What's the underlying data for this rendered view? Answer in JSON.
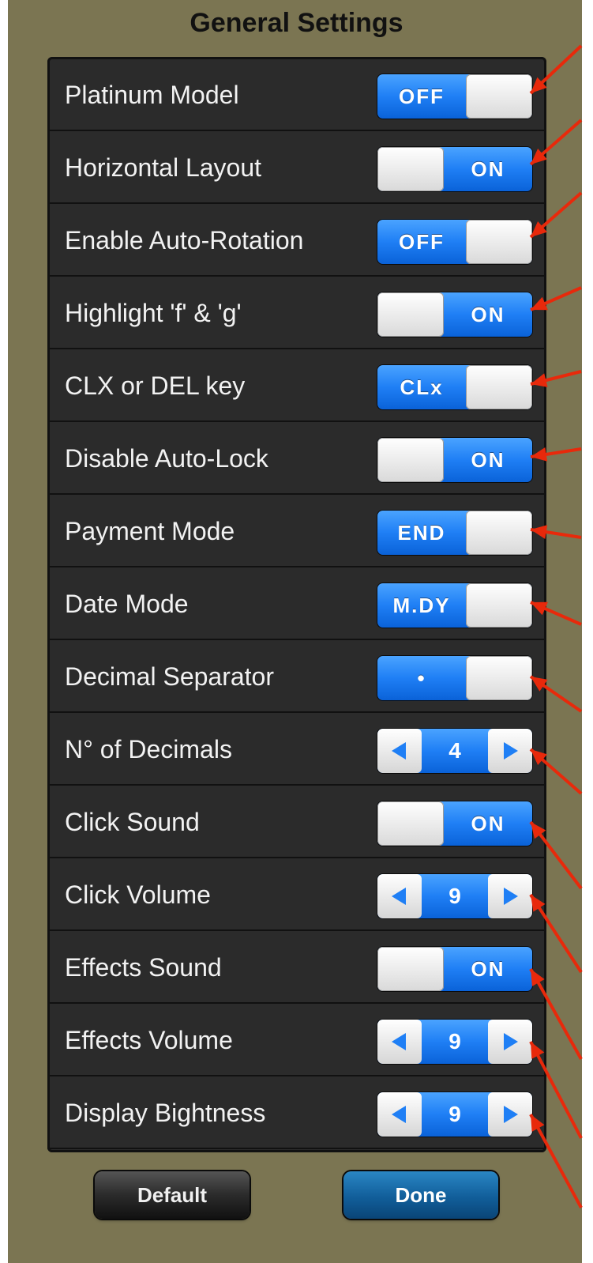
{
  "title": "General Settings",
  "rows": [
    {
      "label": "Platinum Model",
      "control": "switch",
      "state": "off",
      "text": "OFF"
    },
    {
      "label": "Horizontal Layout",
      "control": "switch",
      "state": "on",
      "text": "ON"
    },
    {
      "label": "Enable Auto-Rotation",
      "control": "switch",
      "state": "off",
      "text": "OFF"
    },
    {
      "label": "Highlight 'f' & 'g'",
      "control": "switch",
      "state": "on",
      "text": "ON"
    },
    {
      "label": "CLX or DEL key",
      "control": "switch",
      "state": "off",
      "text": "CLx"
    },
    {
      "label": "Disable Auto-Lock",
      "control": "switch",
      "state": "on",
      "text": "ON"
    },
    {
      "label": "Payment Mode",
      "control": "switch",
      "state": "off",
      "text": "END"
    },
    {
      "label": "Date Mode",
      "control": "switch",
      "state": "off",
      "text": "M.DY"
    },
    {
      "label": "Decimal Separator",
      "control": "switch",
      "state": "off",
      "text": "•"
    },
    {
      "label": "N° of Decimals",
      "control": "stepper",
      "text": "4"
    },
    {
      "label": "Click Sound",
      "control": "switch",
      "state": "on",
      "text": "ON"
    },
    {
      "label": "Click Volume",
      "control": "stepper",
      "text": "9"
    },
    {
      "label": "Effects Sound",
      "control": "switch",
      "state": "on",
      "text": "ON"
    },
    {
      "label": "Effects Volume",
      "control": "stepper",
      "text": "9"
    },
    {
      "label": "Display Bightness",
      "control": "stepper",
      "text": "9"
    }
  ],
  "buttons": {
    "default_label": "Default",
    "done_label": "Done"
  },
  "colors": {
    "background": "#7b7552",
    "panel": "#2b2b2b",
    "accent_blue": "#1f7ff5",
    "annotation_arrow": "#e8290b"
  },
  "icons": {
    "stepper_left": "left-triangle-icon",
    "stepper_right": "right-triangle-icon",
    "annotation": "red-arrow-icon"
  }
}
